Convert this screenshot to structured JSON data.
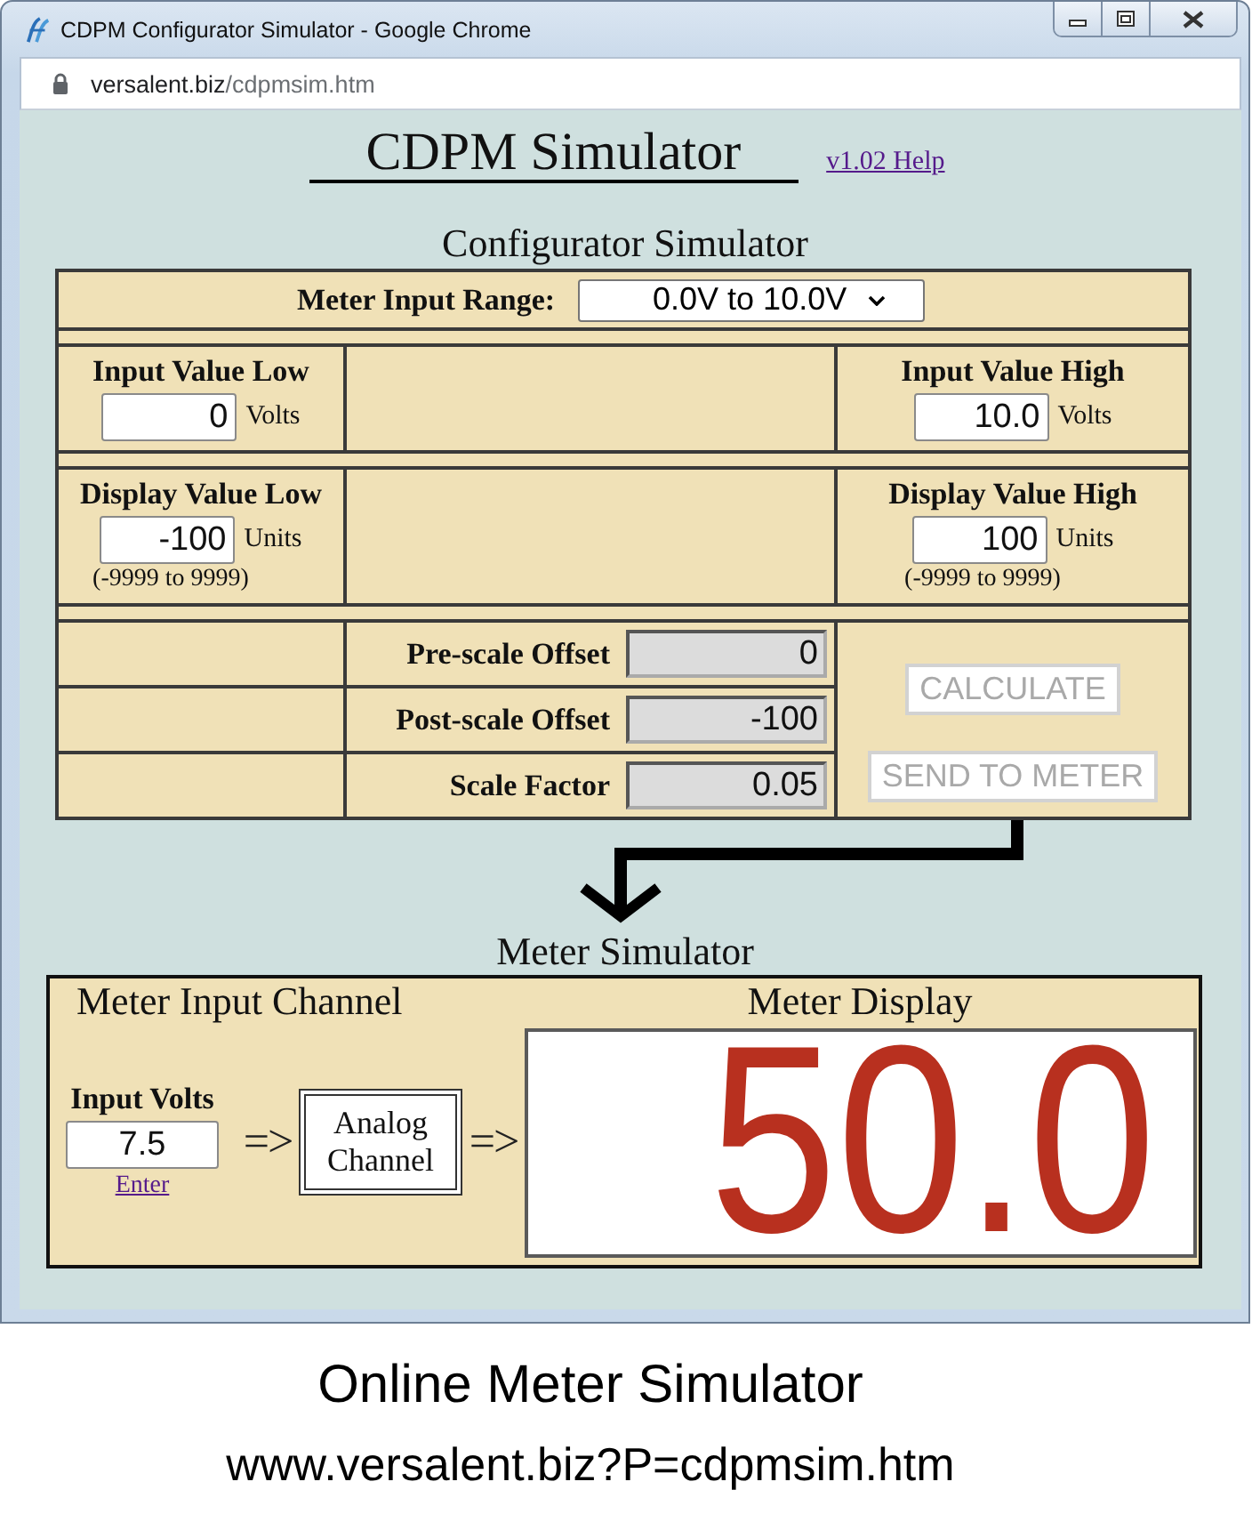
{
  "window": {
    "title": "CDPM Configurator Simulator - Google Chrome"
  },
  "address_bar": {
    "domain": "versalent.biz",
    "path": "/cdpmsim.htm"
  },
  "header": {
    "title": "CDPM Simulator",
    "help_link": "v1.02 Help"
  },
  "configurator": {
    "title": "Configurator Simulator",
    "range": {
      "label": "Meter Input Range:",
      "value": "0.0V to 10.0V"
    },
    "value_rows": [
      {
        "left": {
          "label": "Input Value Low",
          "value": "0",
          "unit": "Volts"
        },
        "right": {
          "label": "Input Value High",
          "value": "10.0",
          "unit": "Volts"
        }
      },
      {
        "left": {
          "label": "Display Value Low",
          "value": "-100",
          "unit": "Units",
          "hint": "(-9999 to 9999)"
        },
        "right": {
          "label": "Display Value High",
          "value": "100",
          "unit": "Units",
          "hint": "(-9999 to 9999)"
        }
      }
    ],
    "results": [
      {
        "label": "Pre-scale Offset",
        "value": "0"
      },
      {
        "label": "Post-scale Offset",
        "value": "-100"
      },
      {
        "label": "Scale Factor",
        "value": "0.05"
      }
    ],
    "buttons": [
      {
        "label": "CALCULATE",
        "disabled": true
      },
      {
        "label": "SEND TO METER",
        "disabled": true
      }
    ]
  },
  "meter": {
    "title": "Meter Simulator",
    "input_channel": {
      "title": "Meter Input Channel",
      "label": "Input Volts",
      "value": "7.5",
      "link": "Enter",
      "arrow_in": "=>",
      "block": "Analog Channel",
      "arrow_out": "=>"
    },
    "display": {
      "title": "Meter Display",
      "reading": "50.0"
    }
  },
  "caption": {
    "title": "Online Meter Simulator",
    "url": "www.versalent.biz?P=cdpmsim.htm"
  }
}
